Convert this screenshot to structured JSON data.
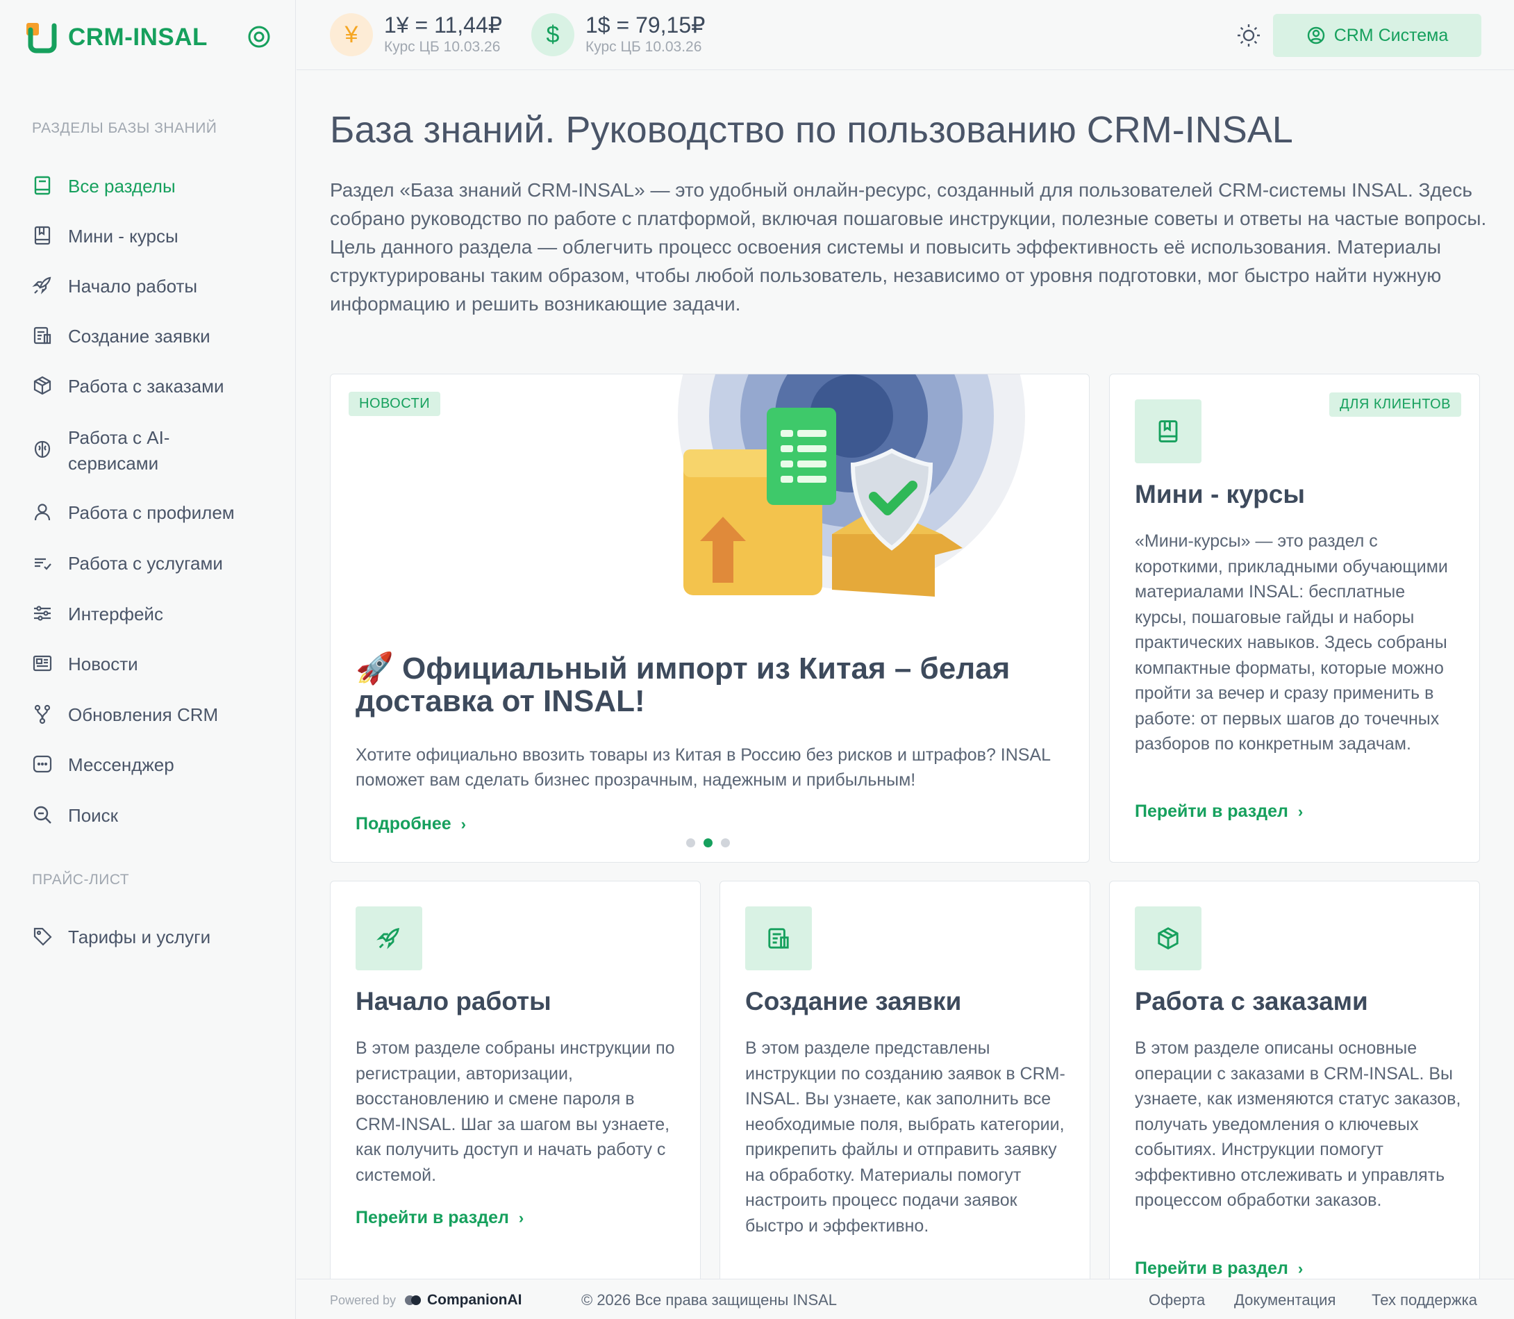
{
  "brand": {
    "name": "CRM-INSAL"
  },
  "sidebar": {
    "section1": "РАЗДЕЛЫ БАЗЫ ЗНАНИЙ",
    "items": [
      {
        "label": "Все разделы",
        "icon": "book-icon",
        "active": true
      },
      {
        "label": "Мини - курсы",
        "icon": "book-open-icon"
      },
      {
        "label": "Начало работы",
        "icon": "rocket-icon"
      },
      {
        "label": "Создание заявки",
        "icon": "form-icon"
      },
      {
        "label": "Работа с заказами",
        "icon": "package-icon"
      },
      {
        "label": "Работа с AI-сервисами",
        "icon": "brain-icon"
      },
      {
        "label": "Работа с профилем",
        "icon": "user-icon"
      },
      {
        "label": "Работа с услугами",
        "icon": "list-icon"
      },
      {
        "label": "Интерфейс",
        "icon": "sliders-icon"
      },
      {
        "label": "Новости",
        "icon": "newspaper-icon"
      },
      {
        "label": "Обновления CRM",
        "icon": "git-branch-icon"
      },
      {
        "label": "Мессенджер",
        "icon": "message-icon"
      },
      {
        "label": "Поиск",
        "icon": "search-icon"
      }
    ],
    "section2": "ПРАЙС-ЛИСТ",
    "price_items": [
      {
        "label": "Тарифы и услуги",
        "icon": "tag-icon"
      }
    ]
  },
  "header": {
    "rates": [
      {
        "value": "1¥ = 11,44₽",
        "sub": "Курс ЦБ 10.03.26",
        "symbol": "¥",
        "color": "#f5a623"
      },
      {
        "value": "1$ = 79,15₽",
        "sub": "Курс ЦБ 10.03.26",
        "symbol": "$",
        "color": "#16a05d"
      }
    ],
    "crm_button": "CRM Система"
  },
  "main": {
    "title": "База знаний. Руководство по пользованию CRM-INSAL",
    "intro": [
      "Раздел «База знаний CRM-INSAL» — это удобный онлайн-ресурс, созданный для пользователей CRM-системы INSAL. Здесь собрано руководство по работе с платформой, включая пошаговые инструкции, полезные советы и ответы на частые вопросы.",
      "Цель данного раздела — облегчить процесс освоения системы и повысить эффективность её использования. Материалы структурированы таким образом, чтобы любой пользователь, независимо от уровня подготовки, мог быстро найти нужную информацию и решить возникающие задачи."
    ],
    "news": {
      "badge": "НОВОСТИ",
      "title": "🚀 Официальный импорт из Китая – белая доставка от INSAL!",
      "text": "Хотите официально ввозить товары из Китая в Россию без рисков и штрафов? INSAL поможет вам сделать бизнес прозрачным, надежным и прибыльным!",
      "link": "Подробнее",
      "slide": 2,
      "slides": 3
    },
    "courses": {
      "badge": "ДЛЯ КЛИЕНТОВ",
      "title": "Мини - курсы",
      "text": "«Мини-курсы» — это раздел с короткими, прикладными обучающими материалами INSAL: бесплатные курсы, пошаговые гайды и наборы практических навыков. Здесь собраны компактные форматы, которые можно пройти за вечер и сразу применить в работе: от первых шагов до точечных разборов по конкретным задачам.",
      "link": "Перейти в раздел"
    },
    "cards": [
      {
        "title": "Начало работы",
        "text": "В этом разделе собраны инструкции по регистрации, авторизации, восстановлению и смене пароля в CRM-INSAL. Шаг за шагом вы узнаете, как получить доступ и начать работу с системой.",
        "link": "Перейти в раздел",
        "icon": "rocket-icon"
      },
      {
        "title": "Создание заявки",
        "text": "В этом разделе представлены инструкции по созданию заявок в CRM-INSAL. Вы узнаете, как заполнить все необходимые поля, выбрать категории, прикрепить файлы и отправить заявку на обработку. Материалы помогут настроить процесс подачи заявок быстро и эффективно.",
        "link": "Перейти в раздел",
        "icon": "form-icon"
      },
      {
        "title": "Работа с заказами",
        "text": "В этом разделе описаны основные операции с заказами в CRM-INSAL. Вы узнаете, как изменяются статус заказов, получать уведомления о ключевых событиях. Инструкции помогут эффективно отслеживать и управлять процессом обработки заказов.",
        "link": "Перейти в раздел",
        "icon": "package-icon"
      }
    ]
  },
  "footer": {
    "powered": "Powered by",
    "company": "CompanionAI",
    "copyright": "© 2026 Все права защищены INSAL",
    "links": [
      "Оферта",
      "Документация",
      "Тех поддержка"
    ]
  },
  "colors": {
    "accent": "#16a05d",
    "accent_bg": "#d9f2e4",
    "text": "#4a5568"
  }
}
